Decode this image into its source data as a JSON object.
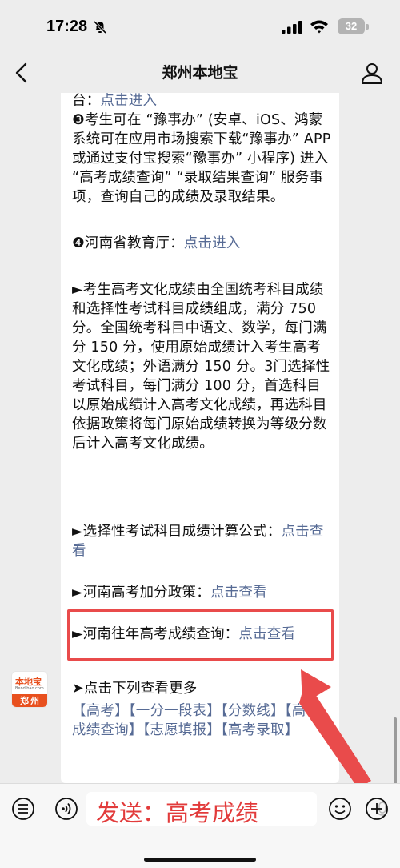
{
  "status_bar": {
    "time": "17:28",
    "battery": "32"
  },
  "nav": {
    "title": "郑州本地宝"
  },
  "article": {
    "line1_prefix": "台：",
    "line1_link": "点击进入",
    "para3": "❸考生可在 “豫事办” (安卓、iOS、鸿蒙系统可在应用市场搜索下载“豫事办” APP 或通过支付宝搜索“豫事办” 小程序) 进入 “高考成绩查询” “录取结果查询” 服务事项，查询自己的成绩及录取结果。",
    "item4_prefix": "❹河南省教育厅：",
    "item4_link": "点击进入",
    "score_para": "►考生高考文化成绩由全国统考科目成绩和选择性考试科目成绩组成，满分 750 分。全国统考科目中语文、数学，每门满分 150 分，使用原始成绩计入考生高考文化成绩；外语满分 150 分。3门选择性考试科目，每门满分 100 分，首选科目以原始成绩计入高考文化成绩，再选科目依据政策将每门原始成绩转换为等级分数后计入高考文化成绩。",
    "formula_prefix": "►选择性考试科目成绩计算公式：",
    "formula_link": "点击查看",
    "bonus_prefix": "►河南高考加分政策：",
    "bonus_link": "点击查看",
    "past_prefix": "►河南往年高考成绩查询：",
    "past_link": "点击查看"
  },
  "avatar": {
    "brand": "本地宝",
    "domain": "Bendibao.com",
    "city": "郑州"
  },
  "more": {
    "title": "➤点击下列查看更多",
    "links_text": "【高考】【一分一段表】【分数线】【高考成绩查询】【志愿填报】【高考录取】"
  },
  "input": {
    "value": "发送：高考成绩"
  },
  "colors": {
    "link": "#576b95",
    "highlight": "#e94b4b",
    "brand": "#e8501e"
  }
}
